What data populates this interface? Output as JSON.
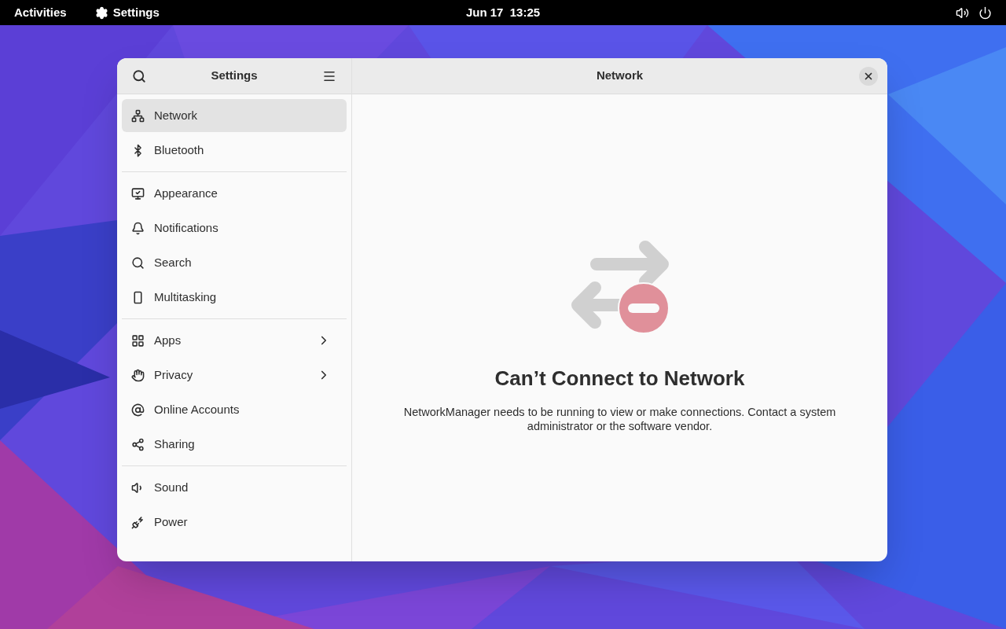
{
  "top_bar": {
    "activities": "Activities",
    "app_menu": "Settings",
    "clock": "Jun 17  13:25"
  },
  "window": {
    "sidebar_title": "Settings",
    "title": "Network"
  },
  "sidebar": {
    "groups": [
      {
        "items": [
          {
            "label": "Network",
            "selected": true,
            "submenu": false
          },
          {
            "label": "Bluetooth",
            "selected": false,
            "submenu": false
          }
        ]
      },
      {
        "items": [
          {
            "label": "Appearance",
            "selected": false,
            "submenu": false
          },
          {
            "label": "Notifications",
            "selected": false,
            "submenu": false
          },
          {
            "label": "Search",
            "selected": false,
            "submenu": false
          },
          {
            "label": "Multitasking",
            "selected": false,
            "submenu": false
          }
        ]
      },
      {
        "items": [
          {
            "label": "Apps",
            "selected": false,
            "submenu": true
          },
          {
            "label": "Privacy",
            "selected": false,
            "submenu": true
          },
          {
            "label": "Online Accounts",
            "selected": false,
            "submenu": false
          },
          {
            "label": "Sharing",
            "selected": false,
            "submenu": false
          }
        ]
      },
      {
        "items": [
          {
            "label": "Sound",
            "selected": false,
            "submenu": false
          },
          {
            "label": "Power",
            "selected": false,
            "submenu": false
          }
        ]
      }
    ]
  },
  "status_page": {
    "title": "Can’t Connect to Network",
    "description": "NetworkManager needs to be running to view or make connections. Contact a system administrator or the software vendor."
  }
}
